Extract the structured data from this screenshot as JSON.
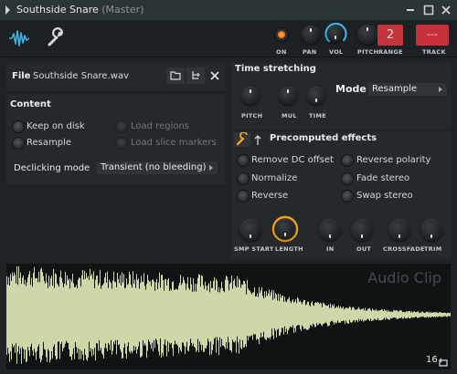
{
  "window": {
    "title": "Southside Snare",
    "subtitle": "(Master)"
  },
  "toolbar": {
    "on_label": "ON",
    "pan_label": "PAN",
    "vol_label": "VOL",
    "pitch_label": "PITCH",
    "range_label": "RANGE",
    "range_value": "2",
    "track_label": "TRACK",
    "track_value": "---"
  },
  "file": {
    "label": "File",
    "name": "Southside Snare.wav"
  },
  "content": {
    "title": "Content",
    "keep_on_disk": "Keep on disk",
    "resample": "Resample",
    "load_regions": "Load regions",
    "load_slice_markers": "Load slice markers",
    "declicking_label": "Declicking mode",
    "declicking_value": "Transient (no bleeding)"
  },
  "time_stretching": {
    "title": "Time stretching",
    "pitch": "PITCH",
    "mul": "MUL",
    "time": "TIME",
    "mode_label": "Mode",
    "mode_value": "Resample"
  },
  "precomputed": {
    "title": "Precomputed effects",
    "remove_dc": "Remove DC offset",
    "normalize": "Normalize",
    "reverse": "Reverse",
    "reverse_polarity": "Reverse polarity",
    "fade_stereo": "Fade stereo",
    "swap_stereo": "Swap stereo",
    "knobs": [
      "SMP START",
      "LENGTH",
      "IN",
      "OUT",
      "CROSSFADE",
      "TRIM"
    ]
  },
  "waveform": {
    "watermark": "Audio Clip",
    "counter": "16"
  },
  "colors": {
    "accent_blue": "#3fb2e8",
    "accent_orange": "#f0a21c",
    "pitch_red": "#c53540",
    "track_red": "#c8303b",
    "wave": "#dfe8b4"
  }
}
